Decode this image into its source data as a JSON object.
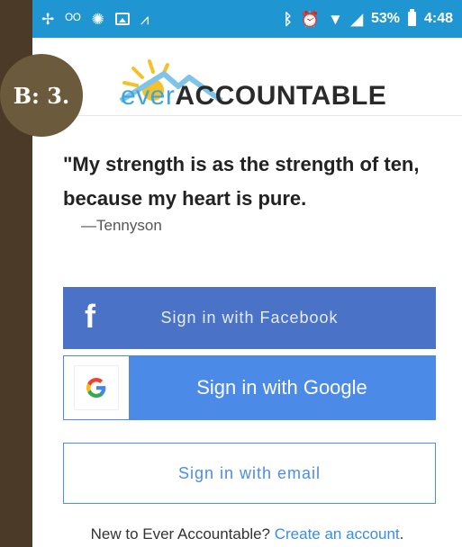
{
  "status_bar": {
    "left_icons": [
      "signal-boost-icon",
      "voicemail-icon",
      "sunburst-icon",
      "image-icon",
      "activity-icon"
    ],
    "right_icons": [
      "bluetooth-icon",
      "alarm-icon",
      "wifi-icon",
      "cellular-icon",
      "battery-icon"
    ],
    "battery": "53%",
    "time": "4:48"
  },
  "logo": {
    "ever": "ever",
    "accountable": "ACCOUNTABLE"
  },
  "badge": {
    "text": "B: 3."
  },
  "quote": {
    "text": "\"My strength is as the strength of ten, because my heart is pure.",
    "attribution": "—Tennyson"
  },
  "buttons": {
    "facebook": "Sign in with Facebook",
    "google": "Sign in with Google",
    "email": "Sign in with email"
  },
  "signup": {
    "prefix": "New to Ever Accountable? ",
    "link": "Create an account",
    "suffix": "."
  },
  "colors": {
    "status_bar": "#1f96d1",
    "facebook": "#4a72c7",
    "google": "#4c8ae8",
    "email_border": "#4b8de8",
    "badge": "#6b5a3b"
  }
}
